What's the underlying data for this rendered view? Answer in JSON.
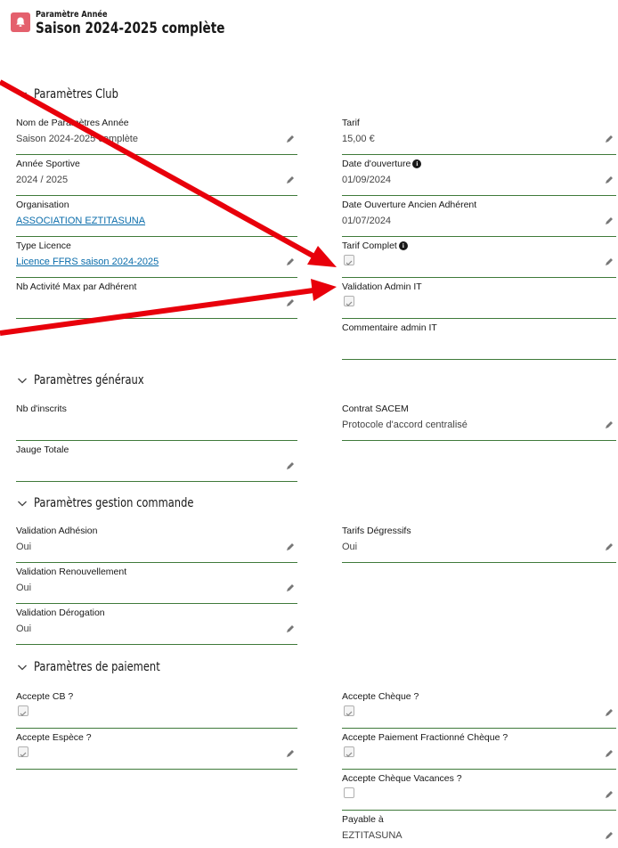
{
  "header": {
    "object_label": "Paramètre Année",
    "title": "Saison 2024-2025 complète"
  },
  "sections": {
    "club": "Paramètres Club",
    "general": "Paramètres généraux",
    "order": "Paramètres gestion commande",
    "payment": "Paramètres de paiement"
  },
  "fields": {
    "nom": {
      "label": "Nom de Paramètres Année",
      "value": "Saison 2024-2025 complète"
    },
    "annee": {
      "label": "Année Sportive",
      "value": "2024 / 2025"
    },
    "organisation": {
      "label": "Organisation",
      "value": "ASSOCIATION EZTITASUNA"
    },
    "type_licence": {
      "label": "Type Licence",
      "value": "Licence FFRS saison 2024-2025"
    },
    "nb_activite": {
      "label": "Nb Activité Max par Adhérent",
      "value": ""
    },
    "tarif": {
      "label": "Tarif",
      "value": "15,00 €"
    },
    "date_ouverture": {
      "label": "Date d'ouverture",
      "value": "01/09/2024"
    },
    "date_ouverture_ancien": {
      "label": "Date Ouverture Ancien Adhérent",
      "value": "01/07/2024"
    },
    "tarif_complet": {
      "label": "Tarif Complet",
      "checked": true
    },
    "validation_admin": {
      "label": "Validation Admin IT",
      "checked": true
    },
    "commentaire_admin": {
      "label": "Commentaire admin IT",
      "value": ""
    },
    "nb_inscrits": {
      "label": "Nb d'inscrits",
      "value": ""
    },
    "jauge_totale": {
      "label": "Jauge Totale",
      "value": ""
    },
    "contrat_sacem": {
      "label": "Contrat SACEM",
      "value": "Protocole d'accord centralisé"
    },
    "validation_adhesion": {
      "label": "Validation Adhésion",
      "value": "Oui"
    },
    "validation_renouvellement": {
      "label": "Validation Renouvellement",
      "value": "Oui"
    },
    "validation_derogation": {
      "label": "Validation Dérogation",
      "value": "Oui"
    },
    "tarifs_degressifs": {
      "label": "Tarifs Dégressifs",
      "value": "Oui"
    },
    "accepte_cb": {
      "label": "Accepte CB ?",
      "checked": true
    },
    "accepte_espece": {
      "label": "Accepte Espèce ?",
      "checked": true
    },
    "accepte_cheque": {
      "label": "Accepte Chèque ?",
      "checked": true
    },
    "accepte_fractionne": {
      "label": "Accepte Paiement Fractionné Chèque ?",
      "checked": true
    },
    "accepte_vacances": {
      "label": "Accepte Chèque Vacances ?",
      "checked": false
    },
    "payable_a": {
      "label": "Payable à",
      "value": "EZTITASUNA"
    }
  },
  "colors": {
    "accent_icon": "#e4606d",
    "field_border": "#3f7a3a",
    "link": "#0b6dab",
    "annotation_arrow": "#e8000b"
  }
}
